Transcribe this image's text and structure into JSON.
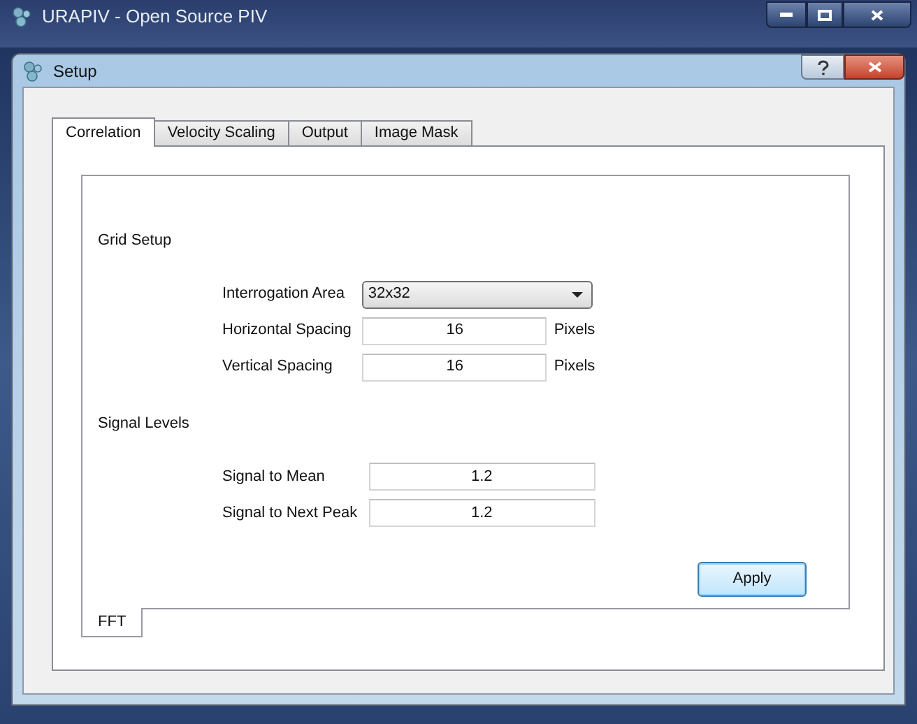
{
  "window": {
    "title": "URAPIV - Open Source PIV"
  },
  "dialog": {
    "title": "Setup"
  },
  "tabs": [
    {
      "label": "Correlation",
      "selected": true
    },
    {
      "label": "Velocity Scaling",
      "selected": false
    },
    {
      "label": "Output",
      "selected": false
    },
    {
      "label": "Image Mask",
      "selected": false
    }
  ],
  "sections": [
    {
      "title": "Grid Setup",
      "fields": [
        {
          "kind": "select",
          "label": "Interrogation Area",
          "value": "32x32"
        },
        {
          "kind": "number",
          "label": "Horizontal Spacing",
          "value": "16",
          "unit": "Pixels"
        },
        {
          "kind": "number",
          "label": "Vertical Spacing",
          "value": "16",
          "unit": "Pixels"
        }
      ]
    },
    {
      "title": "Signal Levels",
      "fields": [
        {
          "kind": "number",
          "label": "Signal to Mean",
          "value": "1.2"
        },
        {
          "kind": "number",
          "label": "Signal to Next Peak",
          "value": "1.2"
        }
      ]
    }
  ],
  "apply_button": "Apply",
  "bottom_tabs": [
    {
      "label": "FFT",
      "selected": true
    }
  ]
}
